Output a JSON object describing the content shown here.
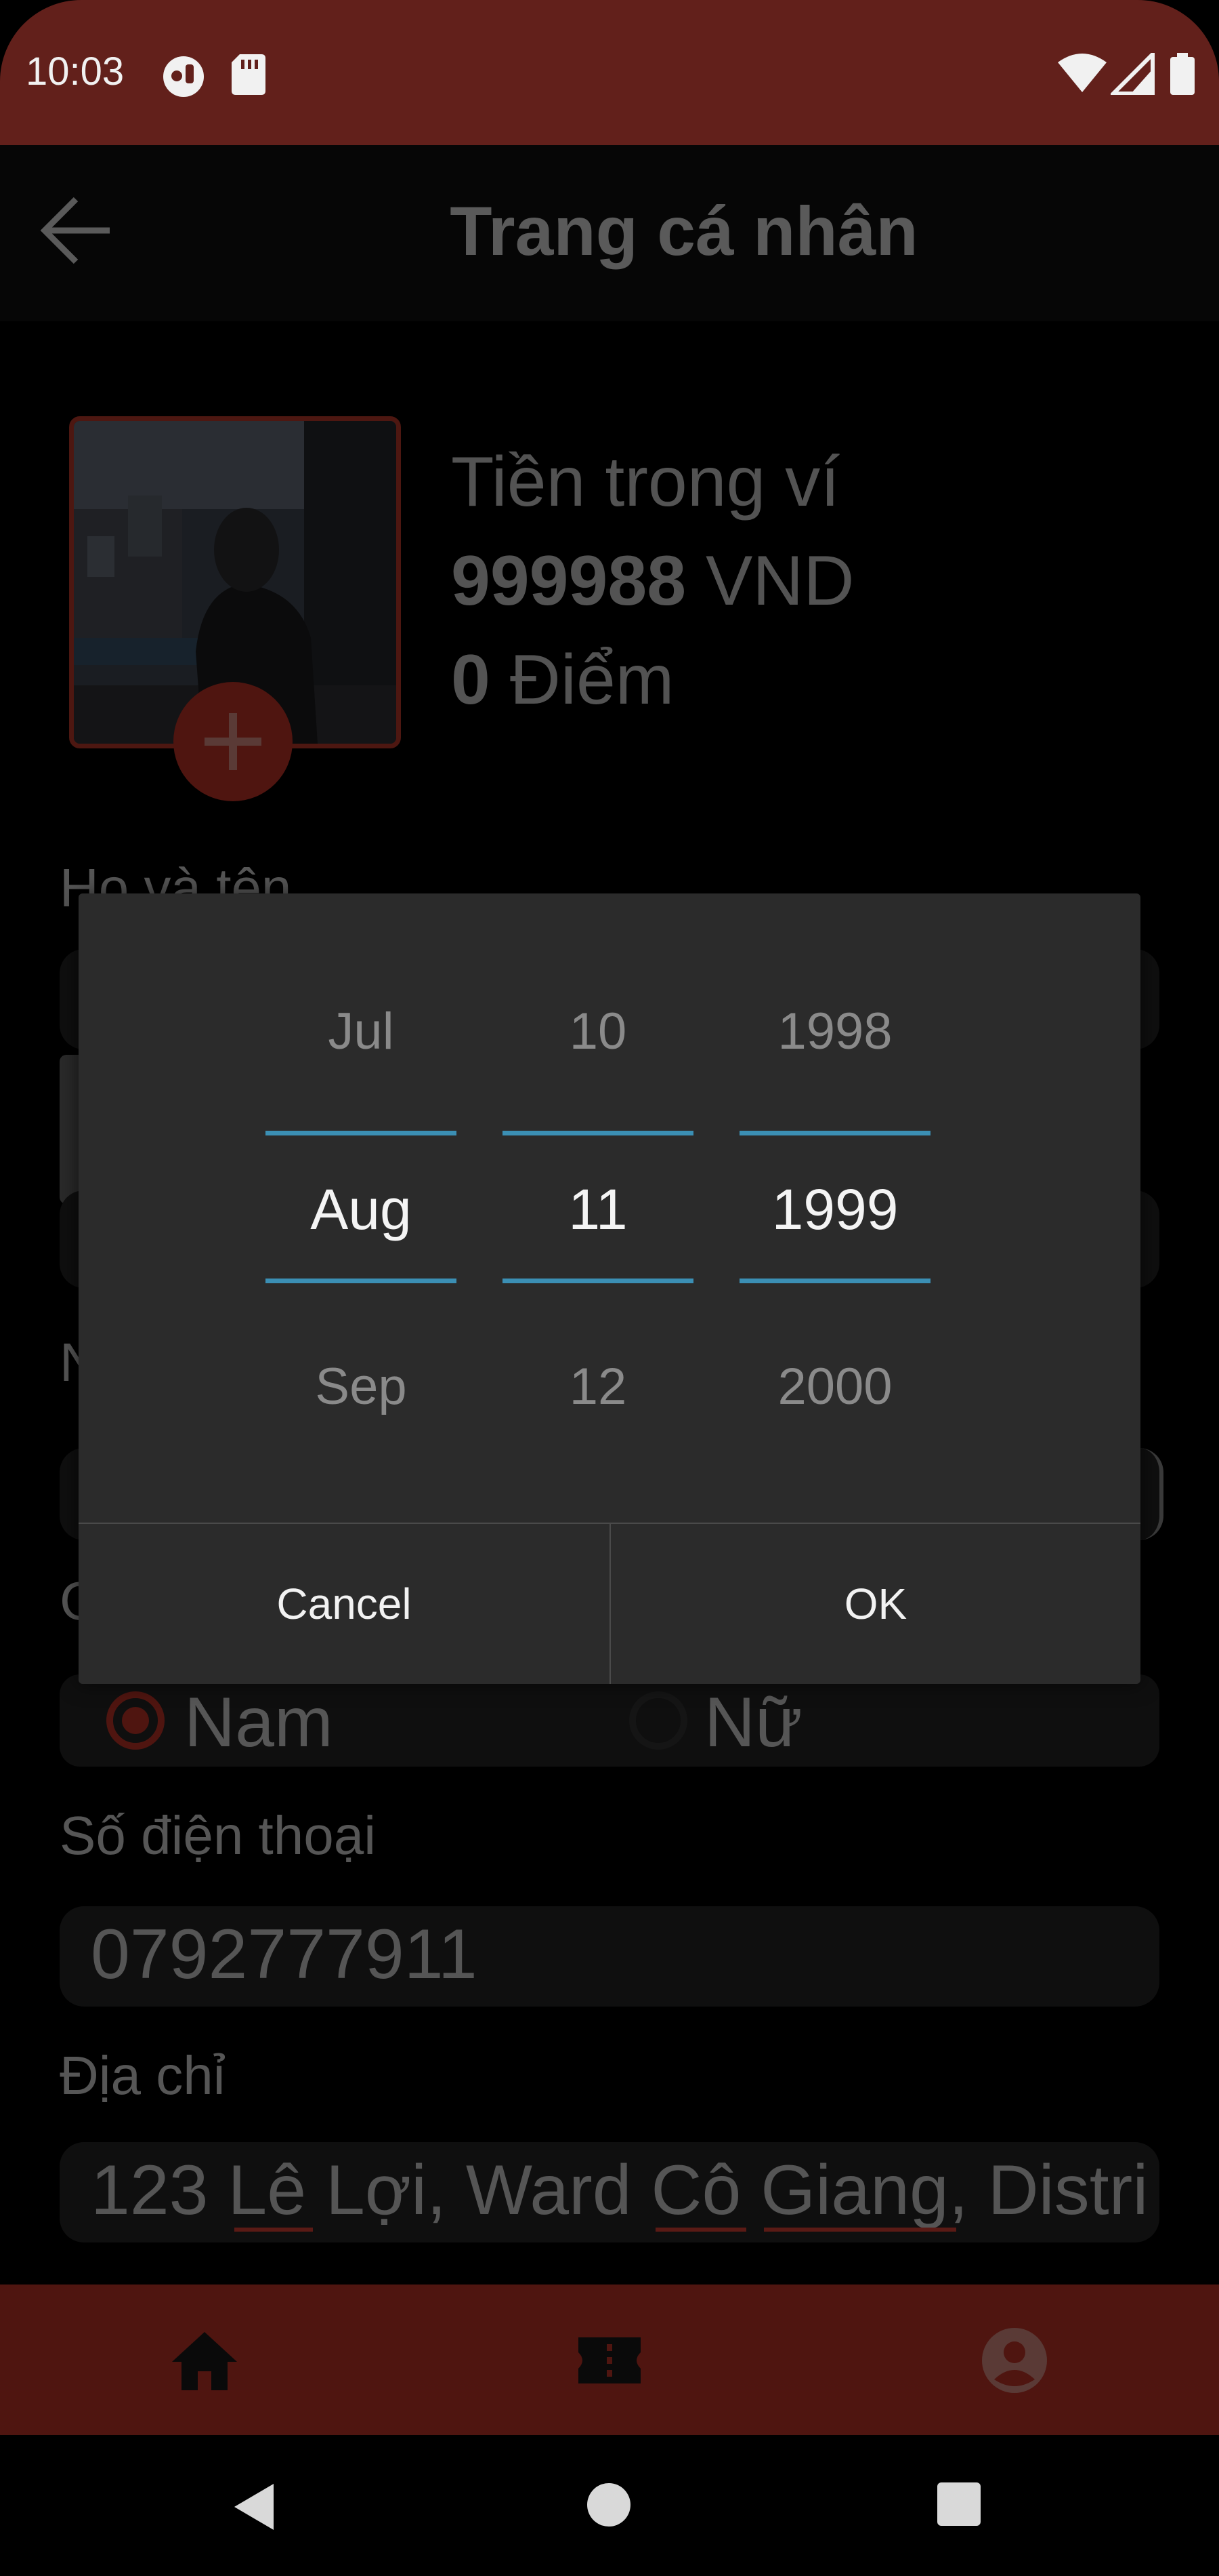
{
  "status_bar": {
    "time": "10:03"
  },
  "app_bar": {
    "title": "Trang cá nhân"
  },
  "profile": {
    "wallet_label": "Tiền trong ví",
    "balance_value": "999988",
    "balance_unit": " VND",
    "points_value": "0",
    "points_unit": " Điểm"
  },
  "form": {
    "full_name_label": "Họ và tên",
    "phone_label": "Số điện thoại",
    "phone_value": "0792777911",
    "address_label": "Địa chỉ",
    "address_value": "123 Lê Lợi, Ward Cô Giang, Distri",
    "gender_options": [
      "Nam",
      "Nữ"
    ],
    "gender_selected": "Nam",
    "partial_label_1": "N",
    "partial_label_2": "G"
  },
  "date_picker": {
    "months": {
      "prev": "Jul",
      "selected": "Aug",
      "next": "Sep"
    },
    "days": {
      "prev": "10",
      "selected": "11",
      "next": "12"
    },
    "years": {
      "prev": "1998",
      "selected": "1999",
      "next": "2000"
    },
    "cancel_label": "Cancel",
    "ok_label": "OK"
  },
  "colors": {
    "accent": "#b32d22",
    "picker_line": "#3b8fb4",
    "dialog_bg": "#2b2b2b"
  },
  "icons": [
    "sim-icon",
    "sd-card-icon",
    "wifi-icon",
    "signal-icon",
    "battery-icon",
    "back-arrow-icon",
    "plus-icon",
    "home-icon",
    "ticket-icon",
    "account-icon"
  ]
}
